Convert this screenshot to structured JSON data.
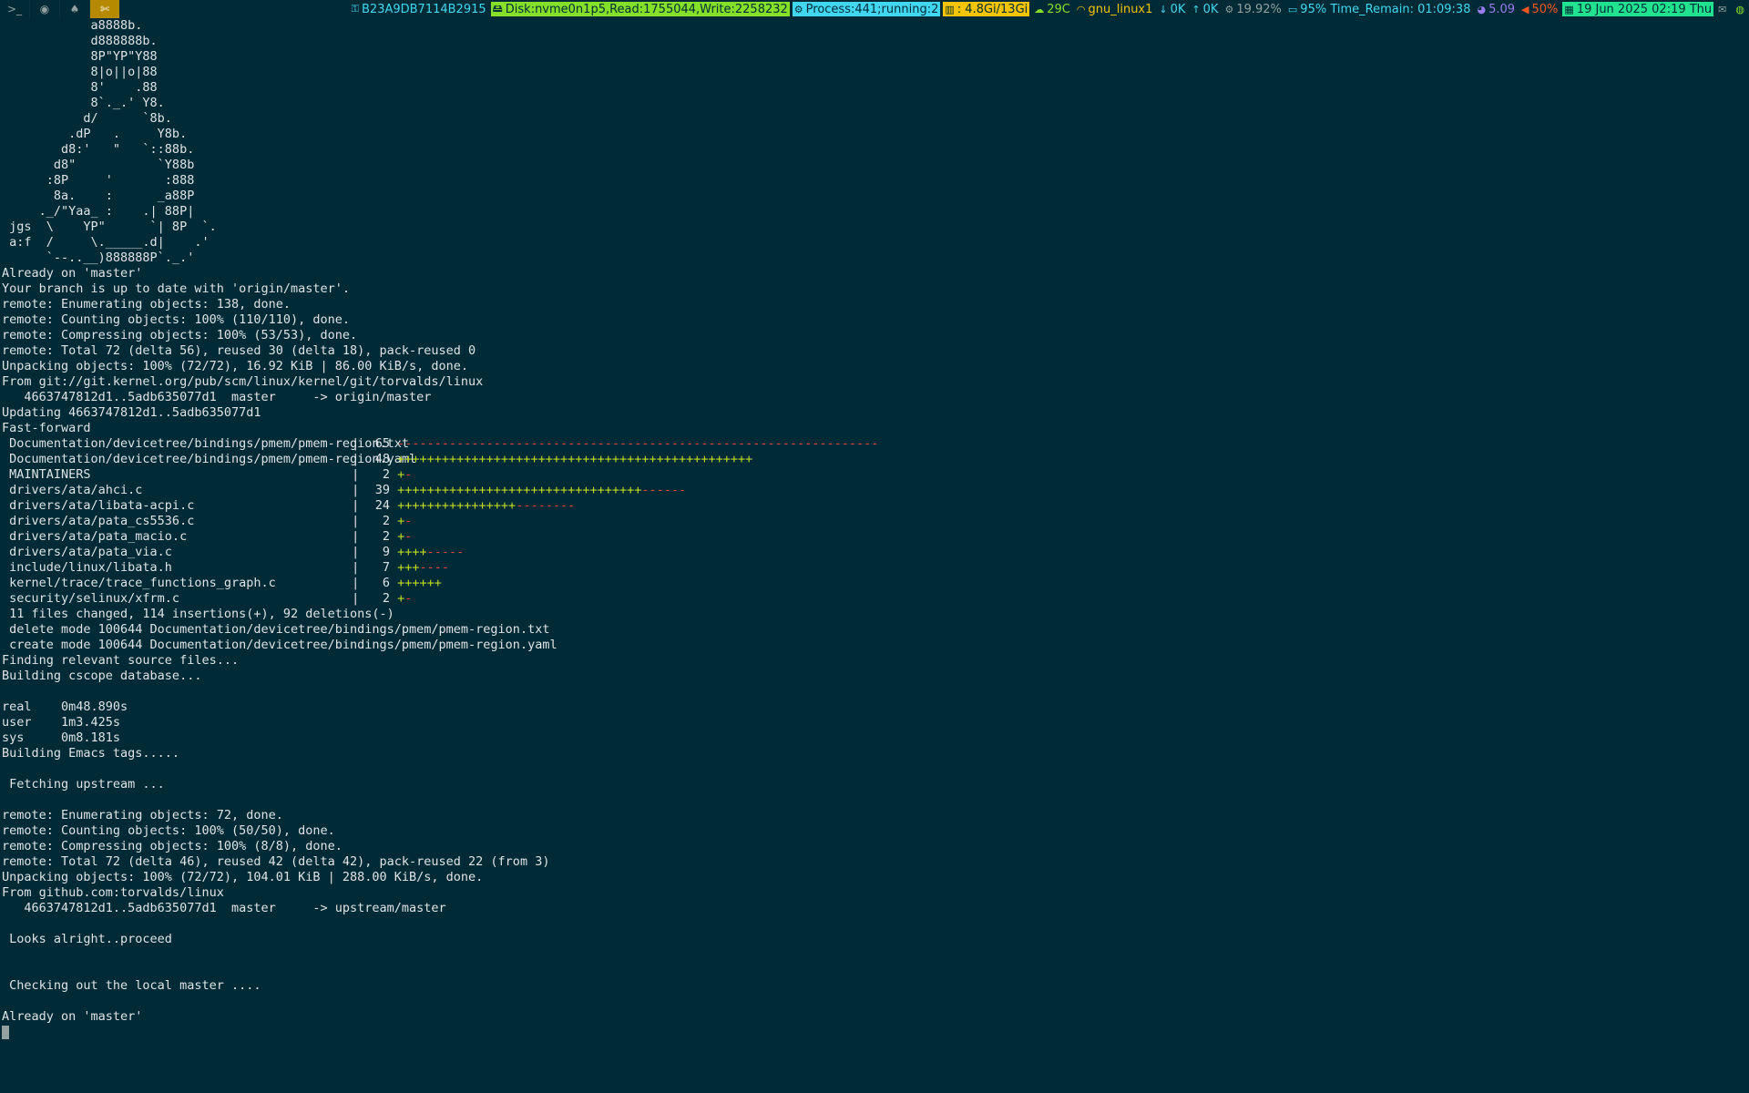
{
  "statusbar": {
    "workspaces": [
      {
        "icon": ">_",
        "name": "terminal-icon",
        "active": false
      },
      {
        "icon": "◉",
        "name": "browser-icon",
        "active": false
      },
      {
        "icon": "♠",
        "name": "linux-penguin-icon",
        "active": false
      },
      {
        "icon": "✄",
        "name": "tools-icon",
        "active": true
      }
    ],
    "items": [
      {
        "key": "serial",
        "icon": "⚿",
        "text": "B23A9DB7114B2915",
        "color": "#41d7f0",
        "style": "plain"
      },
      {
        "key": "disk",
        "icon": "🖴",
        "text": "Disk:nvme0n1p5,Read:1755044,Write:2258232",
        "color": "#002b36",
        "style": "hl"
      },
      {
        "key": "process",
        "icon": "⚙",
        "text": "Process:441;running:2",
        "color": "#002b36",
        "style": "proc"
      },
      {
        "key": "memory",
        "icon": "▥",
        "text": ": 4.8Gi/13Gi",
        "color": "#002b36",
        "style": "mem"
      },
      {
        "key": "temp",
        "icon": "☁",
        "text": "29C",
        "color": "#85e02a",
        "style": "plain"
      },
      {
        "key": "wifi",
        "icon": "◠",
        "text": "gnu_linux1",
        "color": "#f5c400",
        "style": "plain"
      },
      {
        "key": "down",
        "icon": "↓",
        "text": "0K",
        "color": "#41d7f0",
        "style": "plain"
      },
      {
        "key": "up",
        "icon": "↑",
        "text": "0K",
        "color": "#41d7f0",
        "style": "plain"
      },
      {
        "key": "cpu",
        "icon": "⚙",
        "text": "19.92%",
        "color": "#93a1a1",
        "style": "plain"
      },
      {
        "key": "battery",
        "icon": "▭",
        "text": "95% Time_Remain: 01:09:38",
        "color": "#41d7f0",
        "style": "plain"
      },
      {
        "key": "load",
        "icon": "◕",
        "text": "5.09",
        "color": "#9b7bf0",
        "style": "plain"
      },
      {
        "key": "volume",
        "icon": "◀",
        "text": "50%",
        "color": "#ff5722",
        "style": "plain"
      },
      {
        "key": "date",
        "icon": "▦",
        "text": "19 Jun 2025 02:19 Thu",
        "color": "#002b36",
        "style": "date"
      },
      {
        "key": "mail",
        "icon": "✉",
        "text": "",
        "color": "#93a1a1",
        "style": "plain"
      },
      {
        "key": "tray",
        "icon": "◍",
        "text": "",
        "color": "#85e02a",
        "style": "plain"
      }
    ]
  },
  "terminal": {
    "ascii_art": [
      "            a8888b.",
      "            d888888b.",
      "            8P\"YP\"Y88",
      "            8|o||o|88",
      "            8'    .88",
      "            8`._.' Y8.",
      "           d/      `8b.",
      "         .dP   .     Y8b.",
      "        d8:'   \"   `::88b.",
      "       d8\"           `Y88b",
      "      :8P     '       :888",
      "       8a.    :      _a88P",
      "     ._/\"Yaa_ :    .| 88P|",
      " jgs  \\    YP\"      `| 8P  `.",
      " a:f  /     \\._____.d|    .'",
      "      `--..__)888888P`._.'"
    ],
    "git_pull_lines": [
      "Already on 'master'",
      "Your branch is up to date with 'origin/master'.",
      "remote: Enumerating objects: 138, done.",
      "remote: Counting objects: 100% (110/110), done.",
      "remote: Compressing objects: 100% (53/53), done.",
      "remote: Total 72 (delta 56), reused 30 (delta 18), pack-reused 0",
      "Unpacking objects: 100% (72/72), 16.92 KiB | 86.00 KiB/s, done.",
      "From git://git.kernel.org/pub/scm/linux/kernel/git/torvalds/linux",
      "   4663747812d1..5adb635077d1  master     -> origin/master",
      "Updating 4663747812d1..5adb635077d1",
      "Fast-forward"
    ],
    "diffstat": [
      {
        "file": " Documentation/devicetree/bindings/pmem/pmem-region.txt",
        "count": "65",
        "plus": "",
        "minus": "-----------------------------------------------------------------"
      },
      {
        "file": " Documentation/devicetree/bindings/pmem/pmem-region.yaml",
        "count": "48",
        "plus": "++++++++++++++++++++++++++++++++++++++++++++++++",
        "minus": ""
      },
      {
        "file": " MAINTAINERS",
        "count": "2",
        "plus": "+",
        "minus": "-"
      },
      {
        "file": " drivers/ata/ahci.c",
        "count": "39",
        "plus": "+++++++++++++++++++++++++++++++++",
        "minus": "------"
      },
      {
        "file": " drivers/ata/libata-acpi.c",
        "count": "24",
        "plus": "++++++++++++++++",
        "minus": "--------"
      },
      {
        "file": " drivers/ata/pata_cs5536.c",
        "count": "2",
        "plus": "+",
        "minus": "-"
      },
      {
        "file": " drivers/ata/pata_macio.c",
        "count": "2",
        "plus": "+",
        "minus": "-"
      },
      {
        "file": " drivers/ata/pata_via.c",
        "count": "9",
        "plus": "++++",
        "minus": "-----"
      },
      {
        "file": " include/linux/libata.h",
        "count": "7",
        "plus": "+++",
        "minus": "----"
      },
      {
        "file": " kernel/trace/trace_functions_graph.c",
        "count": "6",
        "plus": "++++++",
        "minus": ""
      },
      {
        "file": " security/selinux/xfrm.c",
        "count": "2",
        "plus": "+",
        "minus": "-"
      }
    ],
    "summary_lines": [
      " 11 files changed, 114 insertions(+), 92 deletions(-)",
      " delete mode 100644 Documentation/devicetree/bindings/pmem/pmem-region.txt",
      " create mode 100644 Documentation/devicetree/bindings/pmem/pmem-region.yaml",
      "Finding relevant source files...",
      "Building cscope database...",
      "",
      "real    0m48.890s",
      "user    1m3.425s",
      "sys     0m8.181s",
      "Building Emacs tags.....",
      "",
      " Fetching upstream ...",
      "",
      "remote: Enumerating objects: 72, done.",
      "remote: Counting objects: 100% (50/50), done.",
      "remote: Compressing objects: 100% (8/8), done.",
      "remote: Total 72 (delta 46), reused 42 (delta 42), pack-reused 22 (from 3)",
      "Unpacking objects: 100% (72/72), 104.01 KiB | 288.00 KiB/s, done.",
      "From github.com:torvalds/linux",
      "   4663747812d1..5adb635077d1  master     -> upstream/master",
      "",
      " Looks alright..proceed",
      "",
      "",
      " Checking out the local master ....",
      "",
      "Already on 'master'"
    ]
  }
}
